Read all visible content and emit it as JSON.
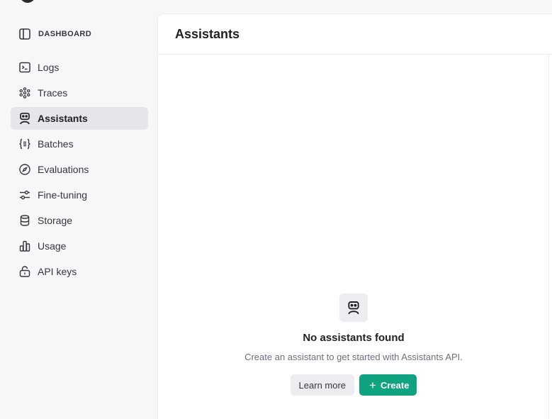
{
  "sidebar": {
    "header": {
      "label": "DASHBOARD",
      "icon": "sidebar-toggle-icon"
    },
    "items": [
      {
        "label": "Logs",
        "icon": "terminal-icon"
      },
      {
        "label": "Traces",
        "icon": "traces-icon"
      },
      {
        "label": "Assistants",
        "icon": "robot-icon",
        "active": true
      },
      {
        "label": "Batches",
        "icon": "braces-icon"
      },
      {
        "label": "Evaluations",
        "icon": "compass-icon"
      },
      {
        "label": "Fine-tuning",
        "icon": "sliders-icon"
      },
      {
        "label": "Storage",
        "icon": "database-icon"
      },
      {
        "label": "Usage",
        "icon": "bar-chart-icon"
      },
      {
        "label": "API keys",
        "icon": "lock-icon"
      }
    ]
  },
  "main": {
    "title": "Assistants",
    "empty": {
      "title": "No assistants found",
      "subtitle": "Create an assistant to get started with Assistants API.",
      "learn_more_label": "Learn more",
      "create_label": "Create"
    }
  },
  "colors": {
    "accent": "#10a37f",
    "active_bg": "#e5e5ea",
    "sidebar_bg": "#f7f7f8"
  }
}
